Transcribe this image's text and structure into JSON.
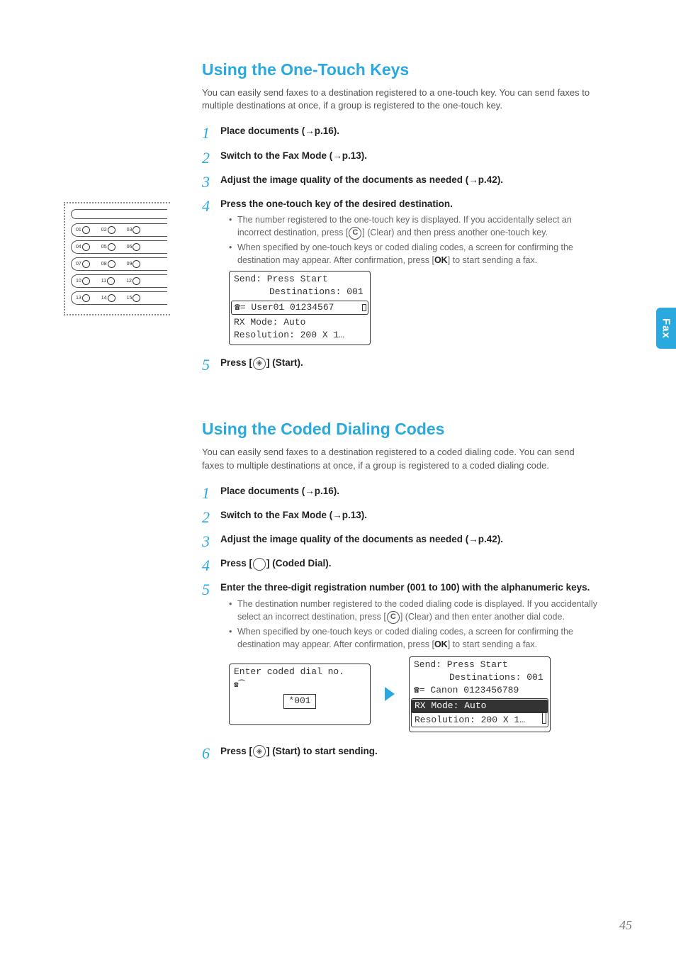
{
  "sideTab": "Fax",
  "pageNumber": "45",
  "section1": {
    "title": "Using the One-Touch Keys",
    "intro": "You can easily send faxes to a destination registered to a one-touch key. You can send faxes to multiple destinations at once, if a group is registered to the one-touch key.",
    "steps": {
      "s1": {
        "num": "1",
        "title": "Place documents (→p.16)."
      },
      "s2": {
        "num": "2",
        "title": "Switch to the Fax Mode (→p.13)."
      },
      "s3": {
        "num": "3",
        "title": "Adjust the image quality of the documents as needed (→p.42)."
      },
      "s4": {
        "num": "4",
        "title": "Press the one-touch key of the desired destination.",
        "b1a": "The number registered to the one-touch key is displayed. If you accidentally select an incorrect destination, press [",
        "b1b": "] (Clear) and then press another one-touch key.",
        "b2a": "When specified by one-touch keys or coded dialing codes, a screen for confirming the destination may appear. After confirmation, press [",
        "b2ok": "OK",
        "b2b": "] to start sending a fax.",
        "lcd": {
          "l1": "Send: Press Start",
          "l2": "Destinations: 001",
          "l3": "☎= User01 01234567",
          "l4": "RX Mode: Auto",
          "l5": "Resolution: 200 X 1…"
        }
      },
      "s5": {
        "num": "5",
        "titleA": "Press [",
        "titleB": "] (Start)."
      }
    }
  },
  "section2": {
    "title": "Using the Coded Dialing Codes",
    "intro": "You can easily send faxes to a destination registered to a coded dialing code. You can send faxes to multiple destinations at once, if a group is registered to a coded dialing code.",
    "steps": {
      "s1": {
        "num": "1",
        "title": "Place documents (→p.16)."
      },
      "s2": {
        "num": "2",
        "title": "Switch to the Fax Mode (→p.13)."
      },
      "s3": {
        "num": "3",
        "title": "Adjust the image quality of the documents as needed (→p.42)."
      },
      "s4": {
        "num": "4",
        "titleA": "Press [",
        "titleB": "] (Coded Dial)."
      },
      "s5": {
        "num": "5",
        "title": "Enter the three-digit registration number (001 to 100) with the alphanumeric keys.",
        "b1a": "The destination number registered to the coded dialing code is displayed. If you accidentally select an incorrect destination, press [",
        "b1b": "] (Clear) and then enter another dial code.",
        "b2a": "When specified by one-touch keys or coded dialing codes, a screen for confirming the destination may appear. After confirmation, press [",
        "b2ok": "OK",
        "b2b": "] to start sending a fax.",
        "lcdL": {
          "l1": "Enter coded dial no.",
          "input": "*001"
        },
        "lcdR": {
          "l1": "Send: Press Start",
          "l2": "Destinations: 001",
          "l3": "☎= Canon 0123456789",
          "l4": "RX Mode: Auto",
          "l5": "Resolution: 200 X 1…"
        }
      },
      "s6": {
        "num": "6",
        "titleA": "Press [",
        "titleB": "] (Start) to start sending."
      }
    }
  },
  "keypad": {
    "rows": [
      [
        "01",
        "02",
        "03"
      ],
      [
        "04",
        "05",
        "06"
      ],
      [
        "07",
        "08",
        "09"
      ],
      [
        "10",
        "11",
        "12"
      ],
      [
        "13",
        "14",
        "15"
      ]
    ]
  },
  "icons": {
    "clear": "C",
    "start": "◈",
    "coded": " "
  }
}
